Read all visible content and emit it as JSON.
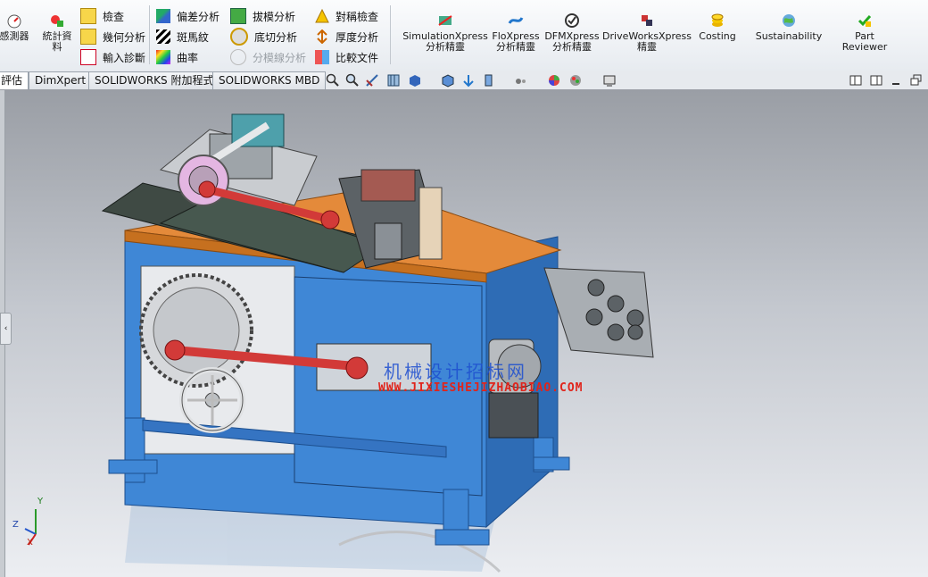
{
  "ribbon": {
    "sensor_label": "感測器",
    "stats_label": "統計資料",
    "check_col": [
      "檢查",
      "幾何分析",
      "輸入診斷"
    ],
    "analysis_col1": [
      "偏差分析",
      "斑馬紋",
      "曲率"
    ],
    "analysis_col2": [
      "拔模分析",
      "底切分析",
      "分模線分析"
    ],
    "analysis_col3": [
      "對稱檢查",
      "厚度分析",
      "比較文件"
    ],
    "tools": [
      {
        "line1": "SimulationXpress",
        "line2": "分析精靈"
      },
      {
        "line1": "FloXpress",
        "line2": "分析精靈"
      },
      {
        "line1": "DFMXpress",
        "line2": "分析精靈"
      },
      {
        "line1": "DriveWorksXpress",
        "line2": "精靈"
      },
      {
        "line1": "Costing",
        "line2": ""
      },
      {
        "line1": "Sustainability",
        "line2": ""
      },
      {
        "line1": "Part",
        "line2": "Reviewer"
      }
    ]
  },
  "tabs": [
    "評估",
    "DimXpert",
    "SOLIDWORKS 附加程式",
    "SOLIDWORKS MBD"
  ],
  "watermark": {
    "line1": "机械设计招标网",
    "line2": "WWW.JIXIESHEJIZHAOBIAO.COM"
  },
  "triad": {
    "x": "X",
    "y": "Y",
    "z": "Z"
  },
  "colors": {
    "frame": "#3f87d6",
    "table_top": "#e48a3a",
    "rod": "#d23a38",
    "accent": "#1e4fd0"
  }
}
